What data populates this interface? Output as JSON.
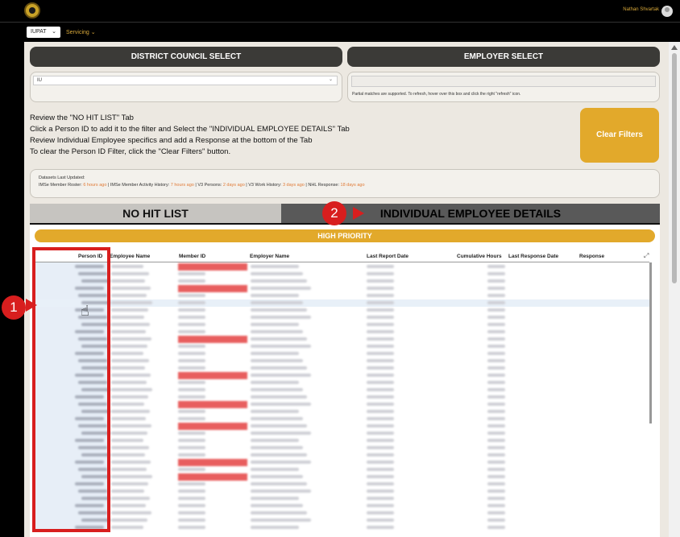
{
  "header": {
    "user_name": "Nathan Shvartak"
  },
  "nav": {
    "org": "IUPAT",
    "servicing": "Servicing"
  },
  "selects": {
    "district_council_title": "DISTRICT COUNCIL SELECT",
    "district_council_value": "IU",
    "employer_title": "EMPLOYER SELECT",
    "employer_note": "Partial matches are supported. To refresh, hover over this box and click the right \"refresh\" icon."
  },
  "instructions": [
    "Review the \"NO HIT LIST\" Tab",
    "Click a Person ID to add it to the filter and Select the \"INDIVIDUAL EMPLOYEE DETAILS\" Tab",
    "Review Individual Employee specifics and add a Response at the bottom of the Tab",
    "To clear the Person ID Filter, click the \"Clear Filters\" button."
  ],
  "clear_filters": "Clear Filters",
  "datasets": {
    "title": "Datasets Last Updated:",
    "items": [
      {
        "label": "IMSe Member Roster:",
        "ago": "6 hours ago"
      },
      {
        "label": "IMSe Member Activity History:",
        "ago": "7 hours ago"
      },
      {
        "label": "V3 Persons:",
        "ago": "2 days ago"
      },
      {
        "label": "V3 Work History:",
        "ago": "3 days ago"
      },
      {
        "label": "NHL Response:",
        "ago": "18 days ago"
      }
    ]
  },
  "tabs": {
    "left": "NO HIT LIST",
    "right": "INDIVIDUAL EMPLOYEE DETAILS"
  },
  "priority_label": "HIGH PRIORITY",
  "table": {
    "columns": [
      "Person ID",
      "Employee Name",
      "Member ID",
      "Employer Name",
      "Last Report Date",
      "Cumulative Hours",
      "Last Response Date",
      "Response"
    ]
  },
  "markers": {
    "one": "1",
    "two": "2"
  },
  "colors": {
    "accent": "#e2a92b",
    "marker": "#d81e1e",
    "header_button": "#3b3a37"
  }
}
